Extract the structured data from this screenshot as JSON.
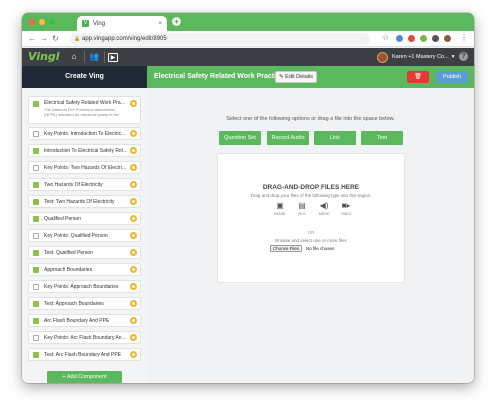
{
  "browser": {
    "tab_title": "Ving",
    "tab_close": "×",
    "new_tab": "+",
    "url": "app.vingapp.com/ving/edit/8905"
  },
  "app_header": {
    "logo": "Vingl",
    "user_name": "Karen +1 Mastery Co...",
    "help": "?"
  },
  "left_panel": {
    "title": "Create Ving",
    "items": [
      {
        "label": "Electrical Safety Related Work Practice...",
        "sub": "The National Fire Protection Association (NFPA) standard for electrical safety in the",
        "icon": "image",
        "color": "#8bc34a"
      },
      {
        "label": "Key Points: Introduction To Electrical S...",
        "icon": "doc",
        "color": "#ffffff"
      },
      {
        "label": "Introduction To Electrical Safety Relate...",
        "icon": "video",
        "color": "#8bc34a"
      },
      {
        "label": "Key Points: Two Hazards Of Electricity",
        "icon": "doc",
        "color": "#ffffff"
      },
      {
        "label": "Two Hazards Of Electricity",
        "icon": "video",
        "color": "#8bc34a"
      },
      {
        "label": "Test: Two Hazards Of Electricity",
        "icon": "test",
        "color": "#8bc34a"
      },
      {
        "label": "Qualified Person",
        "icon": "video",
        "color": "#8bc34a"
      },
      {
        "label": "Key Points: Qualified Person",
        "icon": "doc",
        "color": "#ffffff"
      },
      {
        "label": "Test: Qualified Person",
        "icon": "test",
        "color": "#8bc34a"
      },
      {
        "label": "Approach Boundaries",
        "icon": "video",
        "color": "#8bc34a"
      },
      {
        "label": "Key Points: Approach Boundaries",
        "icon": "doc",
        "color": "#ffffff"
      },
      {
        "label": "Test: Approach Boundaries",
        "icon": "test",
        "color": "#8bc34a"
      },
      {
        "label": "Arc Flash Boundary And PPE",
        "icon": "video",
        "color": "#8bc34a"
      },
      {
        "label": "Key Points: Arc Flash Boundary And PPE",
        "icon": "doc",
        "color": "#ffffff"
      },
      {
        "label": "Test: Arc Flash Boundary And PPE",
        "icon": "test",
        "color": "#8bc34a"
      }
    ],
    "add_component": "+ Add Component"
  },
  "editor": {
    "ving_title": "Electrical Safety Related Work Practices ...",
    "edit_details": "Edit Details",
    "publish": "Publish",
    "instruction": "Select one of the following options or drag a file into the space below.",
    "options": [
      "Question Set",
      "Record Audio",
      "Link",
      "Text"
    ],
    "dropzone": {
      "title": "DRAG-AND-DROP FILES HERE",
      "subtitle": "Drag and drop your files of the following type into this region.",
      "file_types": [
        {
          "label": "IMAGE",
          "icon": "image-icon"
        },
        {
          "label": "FILE",
          "icon": "file-icon"
        },
        {
          "label": "AUDIO",
          "icon": "audio-icon"
        },
        {
          "label": "VIDEO",
          "icon": "video-icon"
        }
      ],
      "or": "OR",
      "browse": "Browse and select one or more files",
      "choose_files": "Choose Files",
      "no_file": "No file chosen"
    }
  },
  "colors": {
    "green": "#5cb85c",
    "dark_header": "#3c3f44",
    "panel_head": "#1f2a36",
    "delete_red": "#e53935",
    "publish_blue": "#5b9bd5",
    "gear_orange": "#f0b429"
  }
}
